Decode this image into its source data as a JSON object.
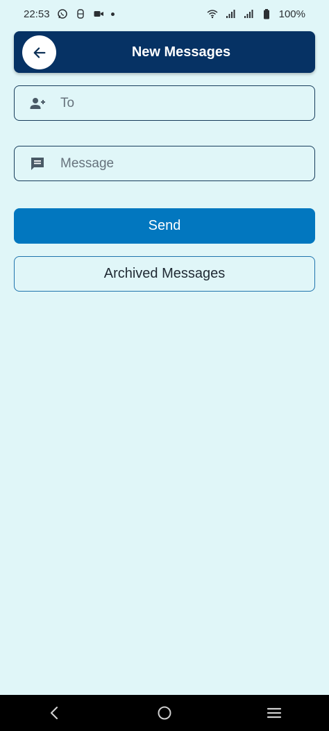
{
  "status_bar": {
    "time": "22:53",
    "battery": "100%",
    "left_icons": [
      "whatsapp-icon",
      "app-icon",
      "video-icon",
      "dot-icon"
    ],
    "right_icons": [
      "wifi-icon",
      "signal-icon",
      "signal-icon",
      "battery-icon"
    ]
  },
  "header": {
    "title": "New Messages",
    "back_icon": "arrow-left-icon",
    "color": "#063264"
  },
  "form": {
    "to": {
      "placeholder": "To",
      "value": "",
      "icon": "person-add-icon"
    },
    "message": {
      "placeholder": "Message",
      "value": "",
      "icon": "chat-bubble-icon"
    }
  },
  "actions": {
    "send_label": "Send",
    "send_color": "#0277bf",
    "archived_label": "Archived Messages"
  },
  "nav_bar": {
    "buttons": [
      "back-nav-icon",
      "home-nav-icon",
      "recents-nav-icon"
    ]
  },
  "background_color": "#e0f6f8"
}
